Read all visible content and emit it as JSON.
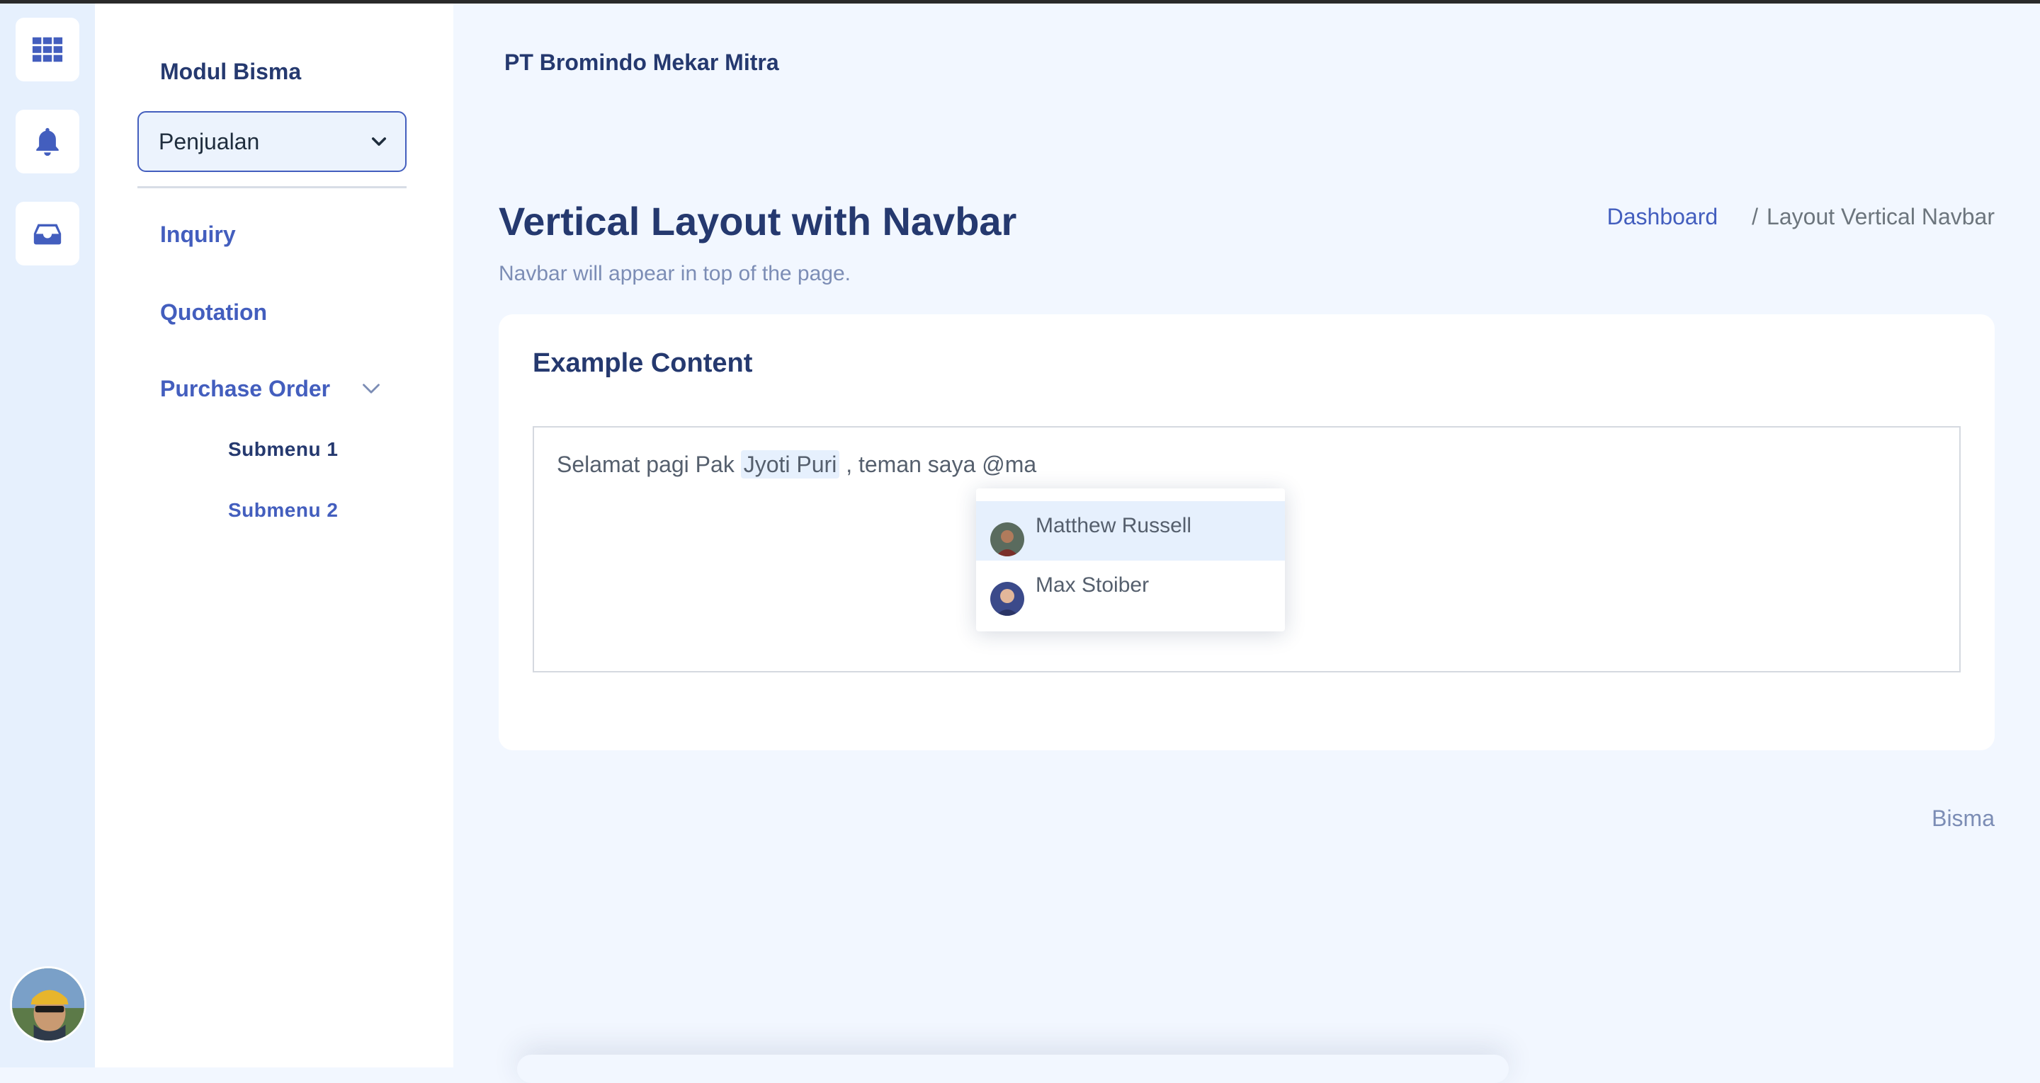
{
  "rail": {
    "items": [
      {
        "icon": "grid-icon"
      },
      {
        "icon": "bell-icon"
      },
      {
        "icon": "inbox-icon"
      }
    ],
    "accent": "#435ebe"
  },
  "sidebar": {
    "module_title": "Modul Bisma",
    "module_select_value": "Penjualan",
    "menu": [
      {
        "label": "Inquiry"
      },
      {
        "label": "Quotation"
      },
      {
        "label": "Purchase Order",
        "expanded": true
      }
    ],
    "submenu": [
      {
        "label": "Submenu 1"
      },
      {
        "label": "Submenu 2"
      }
    ]
  },
  "header": {
    "company": "PT Bromindo Mekar Mitra"
  },
  "page": {
    "title": "Vertical Layout with Navbar",
    "subtitle": "Navbar will appear in top of the page.",
    "breadcrumb": {
      "link": "Dashboard",
      "separator": "/",
      "current": "Layout Vertical Navbar"
    }
  },
  "card": {
    "title": "Example Content",
    "editor": {
      "text_before": "Selamat pagi Pak ",
      "mention": "Jyoti Puri",
      "text_after": " , teman saya @ma"
    },
    "mention_options": [
      {
        "name": "Matthew Russell",
        "active": true
      },
      {
        "name": "Max Stoiber",
        "active": false
      }
    ]
  },
  "footer": {
    "right": "Bisma"
  }
}
